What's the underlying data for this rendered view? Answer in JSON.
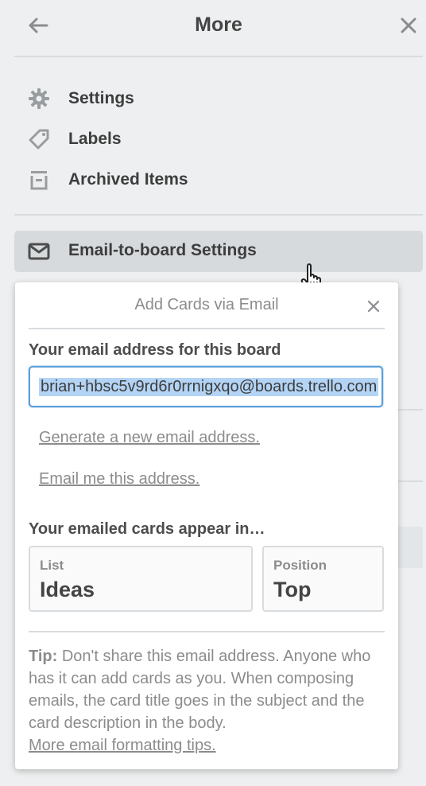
{
  "panel": {
    "title": "More",
    "menu": [
      {
        "label": "Settings",
        "icon": "gear-icon"
      },
      {
        "label": "Labels",
        "icon": "tag-icon"
      },
      {
        "label": "Archived Items",
        "icon": "archive-icon"
      }
    ],
    "email_settings_label": "Email-to-board Settings"
  },
  "popover": {
    "title": "Add Cards via Email",
    "email_label": "Your email address for this board",
    "email_value": "brian+hbsc5v9rd6r0rrnigxqo@boards.trello.com",
    "generate_link": "Generate a new email address.",
    "email_me_link": "Email me this address.",
    "appear_label": "Your emailed cards appear in…",
    "list_select": {
      "label": "List",
      "value": "Ideas"
    },
    "position_select": {
      "label": "Position",
      "value": "Top"
    },
    "tip_bold": "Tip:",
    "tip_text": " Don't share this email address. Anyone who has it can add cards as you. When composing emails, the card title goes in the subject and the card description in the body.",
    "tip_link": "More email formatting tips."
  },
  "colors": {
    "background": "#edeff0",
    "highlight": "#d6dadc",
    "input_border": "#5b9fd9",
    "selection": "#b3d4f5"
  }
}
